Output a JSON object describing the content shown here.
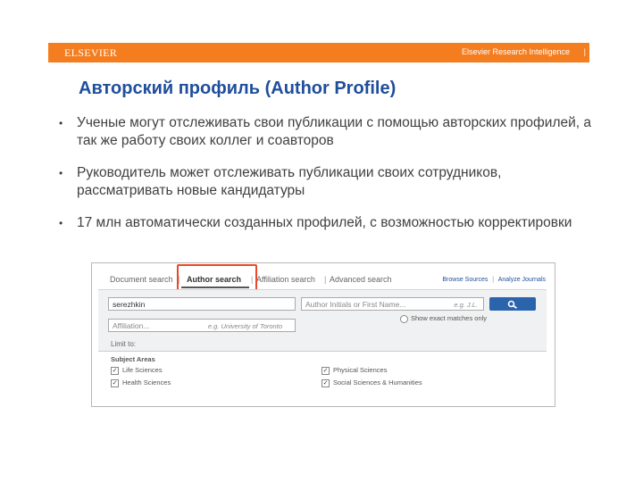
{
  "banner": {
    "logo": "ELSEVIER",
    "right_text": "Elsevier Research Intelligence",
    "mark": "|"
  },
  "slide": {
    "title": "Авторский профиль (Author Profile)",
    "bullet_char": "•",
    "bullets": [
      "Ученые могут отслеживать свои публикации с помощью авторских профилей, а так же работу своих коллег и соавторов",
      "Руководитель может отслеживать публикации своих сотрудников, рассматривать новые кандидатуры",
      "17 млн автоматически созданных профилей, с возможностью корректировки"
    ]
  },
  "scopus": {
    "tabs": {
      "document": "Document search",
      "author": "Author search",
      "affiliation": "Affiliation search",
      "advanced": "Advanced search",
      "sep": "|"
    },
    "links": {
      "browse": "Browse Sources",
      "sep": "|",
      "analyze": "Analyze Journals"
    },
    "help": "?",
    "last_name_value": "serezhkin",
    "initials_placeholder": "Author Initials or First Name...",
    "initials_example": "e.g. J.L.",
    "affiliation_placeholder": "Affiliation...",
    "affiliation_example": "e.g. University of Toronto",
    "exact_match_label": "Show exact matches only",
    "limit_label": "Limit to:",
    "subject_areas_title": "Subject Areas",
    "subjects": [
      {
        "label": "Life Sciences",
        "checked": true
      },
      {
        "label": "Physical Sciences",
        "checked": true
      },
      {
        "label": "Health Sciences",
        "checked": true
      },
      {
        "label": "Social Sciences & Humanities",
        "checked": true
      }
    ],
    "checkmark": "✓",
    "colors": {
      "banner": "#f47d1f",
      "title": "#1f4e9c",
      "highlight": "#e8492b",
      "search_button": "#2a64ac"
    },
    "search_icon": "magnifier-icon"
  }
}
